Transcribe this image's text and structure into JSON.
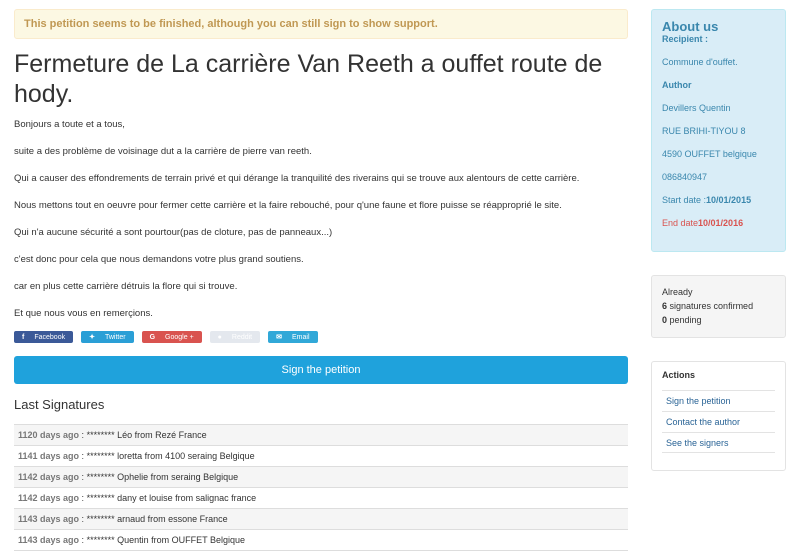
{
  "alert": "This petition seems to be finished, although you can still sign to show support.",
  "title": "Fermeture de La carrière Van Reeth a ouffet route de hody.",
  "body": [
    "Bonjours a toute et a tous,",
    "suite a des problème de voisinage dut a la carrière de pierre van reeth.",
    "Qui a causer des effondrements de terrain privé et qui dérange la tranquilité des riverains qui se trouve aux alentours de cette carrière.",
    "Nous mettons tout en oeuvre pour fermer cette carrière et la faire rebouché, pour q'une faune et flore puisse se réapproprié le site.",
    "Qui n'a aucune sécurité a sont pourtour(pas de cloture, pas de panneaux...)",
    "c'est donc pour cela que nous demandons votre plus grand soutiens.",
    "car en plus cette carrière détruis la flore qui si trouve.",
    "Et que nous vous en remerçions."
  ],
  "share": {
    "facebook": "Facebook",
    "twitter": "Twitter",
    "google": "Google +",
    "reddit": "Reddit",
    "email": "Email"
  },
  "sign_button": "Sign the petition",
  "last_signatures_title": "Last Signatures",
  "signatures": [
    {
      "ago": "1120 days ago",
      "text": "******** Léo from Rezé France"
    },
    {
      "ago": "1141 days ago",
      "text": "******** loretta from 4100 seraing Belgique"
    },
    {
      "ago": "1142 days ago",
      "text": "******** Ophelie from seraing Belgique"
    },
    {
      "ago": "1142 days ago",
      "text": "******** dany et louise from salignac france"
    },
    {
      "ago": "1143 days ago",
      "text": "******** arnaud from essone France"
    },
    {
      "ago": "1143 days ago",
      "text": "******** Quentin from OUFFET Belgique"
    }
  ],
  "about": {
    "heading": "About us",
    "recipient_label": "Recipient :",
    "recipient": "Commune d'ouffet.",
    "author_label": "Author",
    "author_name": "Devillers Quentin",
    "address1": "RUE BRIHI-TIYOU 8",
    "address2": "4590 OUFFET belgique",
    "phone": "086840947",
    "start_label": "Start date :",
    "start_date": "10/01/2015",
    "end_label": "End date",
    "end_date": "10/01/2016"
  },
  "stats": {
    "already": "Already",
    "confirmed_count": "6",
    "confirmed_text": "signatures confirmed",
    "pending_count": "0",
    "pending_text": "pending"
  },
  "actions": {
    "heading": "Actions",
    "items": [
      "Sign the petition",
      "Contact the author",
      "See the signers"
    ]
  },
  "colors": {
    "primary": "#1fa2dc",
    "alert_bg": "#fcf8e3",
    "about_bg": "#d9edf7",
    "end_date": "#d9534f"
  }
}
